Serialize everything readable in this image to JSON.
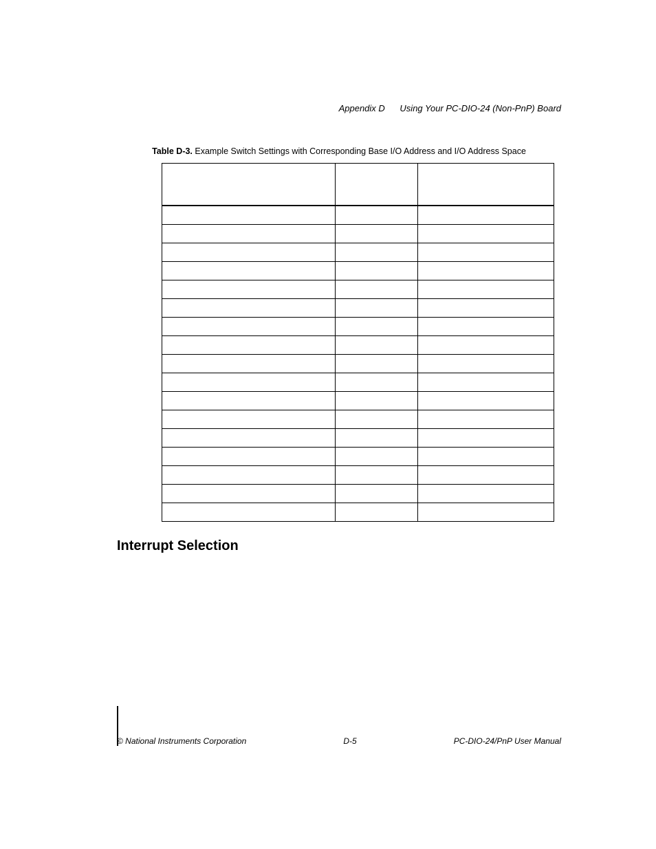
{
  "header": {
    "appendix": "Appendix D",
    "title": "Using Your PC-DIO-24 (Non-PnP) Board"
  },
  "table": {
    "caption_label": "Table D-3.",
    "caption_text": "Example Switch Settings with Corresponding Base I/O Address and I/O Address Space",
    "headers": [
      "",
      "",
      ""
    ],
    "rows": [
      [
        "",
        "",
        ""
      ],
      [
        "",
        "",
        ""
      ],
      [
        "",
        "",
        ""
      ],
      [
        "",
        "",
        ""
      ],
      [
        "",
        "",
        ""
      ],
      [
        "",
        "",
        ""
      ],
      [
        "",
        "",
        ""
      ],
      [
        "",
        "",
        ""
      ],
      [
        "",
        "",
        ""
      ],
      [
        "",
        "",
        ""
      ],
      [
        "",
        "",
        ""
      ],
      [
        "",
        "",
        ""
      ],
      [
        "",
        "",
        ""
      ],
      [
        "",
        "",
        ""
      ],
      [
        "",
        "",
        ""
      ],
      [
        "",
        "",
        ""
      ],
      [
        "",
        "",
        ""
      ]
    ],
    "footer_row": ""
  },
  "section": {
    "heading": "Interrupt Selection"
  },
  "footer": {
    "left": "© National Instruments Corporation",
    "center": "D-5",
    "right": "PC-DIO-24/PnP User Manual"
  }
}
